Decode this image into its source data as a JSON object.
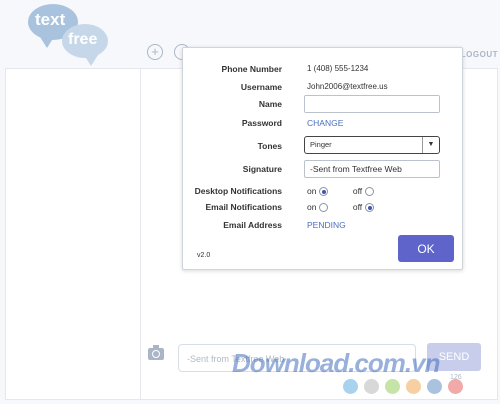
{
  "app": {
    "logo_word1": "text",
    "logo_word2": "free",
    "logout_label": "LOGOUT"
  },
  "composer": {
    "placeholder": "-Sent from Textfree Web",
    "send_label": "SEND",
    "char_count": "126"
  },
  "watermark": "Download.com.vn",
  "theme_colors": [
    "#a9d2ef",
    "#d8d8d8",
    "#c6e3a8",
    "#f8cfa0",
    "#a9c3df",
    "#f1a9a9"
  ],
  "settings": {
    "phone_number_label": "Phone Number",
    "phone_number": "1 (408) 555-1234",
    "username_label": "Username",
    "username": "John2006@textfree.us",
    "name_label": "Name",
    "name_value": "",
    "password_label": "Password",
    "password_action": "CHANGE",
    "tones_label": "Tones",
    "tones_value": "Pinger",
    "signature_label": "Signature",
    "signature_value": "-Sent from Textfree Web",
    "desktop_notifications_label": "Desktop Notifications",
    "email_notifications_label": "Email Notifications",
    "on_label": "on",
    "off_label": "off",
    "desktop_notifications_on": true,
    "email_notifications_on": false,
    "email_address_label": "Email Address",
    "email_address_status": "PENDING",
    "ok_label": "OK",
    "version": "v2.0"
  },
  "icons": {
    "add": "plus-circle-icon",
    "camera": "camera-icon",
    "dropdown": "chevron-down-icon"
  }
}
